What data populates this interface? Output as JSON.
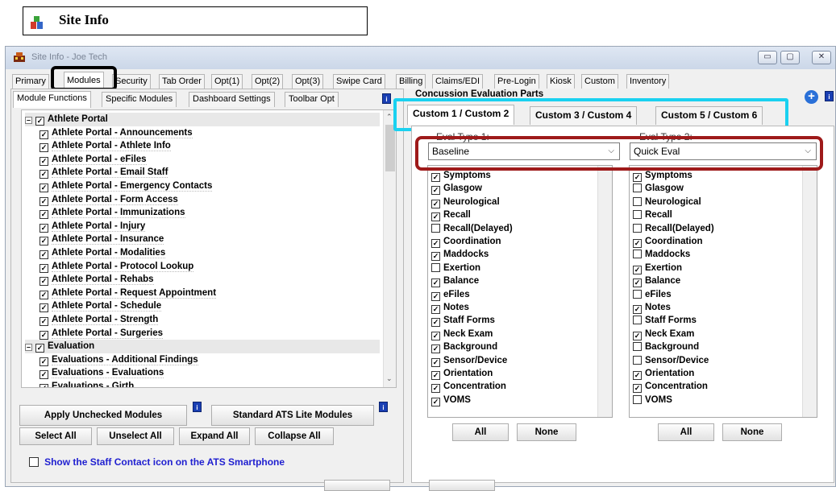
{
  "header": {
    "title": "Site Info"
  },
  "window": {
    "title": "Site Info - Joe Tech",
    "min": "▭",
    "max": "▢",
    "close": "✕"
  },
  "main_tabs": [
    "Primary",
    "Modules",
    "Security",
    "Tab Order",
    "Opt(1)",
    "Opt(2)",
    "Opt(3)",
    "Swipe Card",
    "Billing",
    "Claims/EDI",
    "Pre-Login",
    "Kiosk",
    "Custom",
    "Inventory"
  ],
  "sub_tabs": [
    "Module Functions",
    "Specific Modules",
    "Dashboard Settings",
    "Toolbar Opt"
  ],
  "tree": [
    {
      "label": "Athlete Portal",
      "checked": true,
      "group": true
    },
    {
      "label": "Athlete Portal - Announcements",
      "checked": true
    },
    {
      "label": "Athlete Portal - Athlete Info",
      "checked": true
    },
    {
      "label": "Athlete Portal - eFiles",
      "checked": true
    },
    {
      "label": "Athlete Portal - Email Staff",
      "checked": true
    },
    {
      "label": "Athlete Portal - Emergency Contacts",
      "checked": true
    },
    {
      "label": "Athlete Portal - Form Access",
      "checked": true
    },
    {
      "label": "Athlete Portal - Immunizations",
      "checked": true
    },
    {
      "label": "Athlete Portal - Injury",
      "checked": true
    },
    {
      "label": "Athlete Portal - Insurance",
      "checked": true
    },
    {
      "label": "Athlete Portal - Modalities",
      "checked": true
    },
    {
      "label": "Athlete Portal - Protocol Lookup",
      "checked": true
    },
    {
      "label": "Athlete Portal - Rehabs",
      "checked": true
    },
    {
      "label": "Athlete Portal - Request Appointment",
      "checked": true
    },
    {
      "label": "Athlete Portal - Schedule",
      "checked": true
    },
    {
      "label": "Athlete Portal - Strength",
      "checked": true
    },
    {
      "label": "Athlete Portal - Surgeries",
      "checked": true
    },
    {
      "label": "Evaluation",
      "checked": true,
      "group": true
    },
    {
      "label": "Evaluations - Additional Findings",
      "checked": true
    },
    {
      "label": "Evaluations - Evaluations",
      "checked": true
    },
    {
      "label": "Evaluations - Girth",
      "checked": true
    }
  ],
  "buttons": {
    "apply_unchecked": "Apply Unchecked Modules",
    "standard_lite": "Standard ATS Lite Modules",
    "select_all": "Select All",
    "unselect_all": "Unselect All",
    "expand_all": "Expand All",
    "collapse_all": "Collapse All",
    "all": "All",
    "none": "None"
  },
  "staff_contact": {
    "label": "Show the Staff Contact icon on the ATS Smartphone",
    "checked": false
  },
  "concussion": {
    "title": "Concussion Evaluation Parts",
    "tabs": [
      "Custom 1 / Custom 2",
      "Custom 3 / Custom 4",
      "Custom 5 / Custom 6"
    ],
    "eval_type_1_label": "Eval Type 1:",
    "eval_type_2_label": "Eval Type 2:",
    "eval_type_1": "Baseline",
    "eval_type_2": "Quick Eval",
    "items": [
      "Symptoms",
      "Glasgow",
      "Neurological",
      "Recall",
      "Recall(Delayed)",
      "Coordination",
      "Maddocks",
      "Exertion",
      "Balance",
      "eFiles",
      "Notes",
      "Staff Forms",
      "Neck Exam",
      "Background",
      "Sensor/Device",
      "Orientation",
      "Concentration",
      "VOMS"
    ],
    "checked_1": [
      true,
      true,
      true,
      true,
      false,
      true,
      true,
      false,
      true,
      true,
      true,
      true,
      true,
      true,
      true,
      true,
      true,
      true
    ],
    "checked_2": [
      true,
      false,
      false,
      false,
      false,
      true,
      false,
      true,
      true,
      false,
      true,
      false,
      true,
      false,
      false,
      true,
      true,
      false
    ]
  },
  "colors": {
    "highlight_black": "#000000",
    "highlight_cyan": "#1ad1f0",
    "highlight_red": "#9e1a1a",
    "link_blue": "#1f1fd0"
  }
}
